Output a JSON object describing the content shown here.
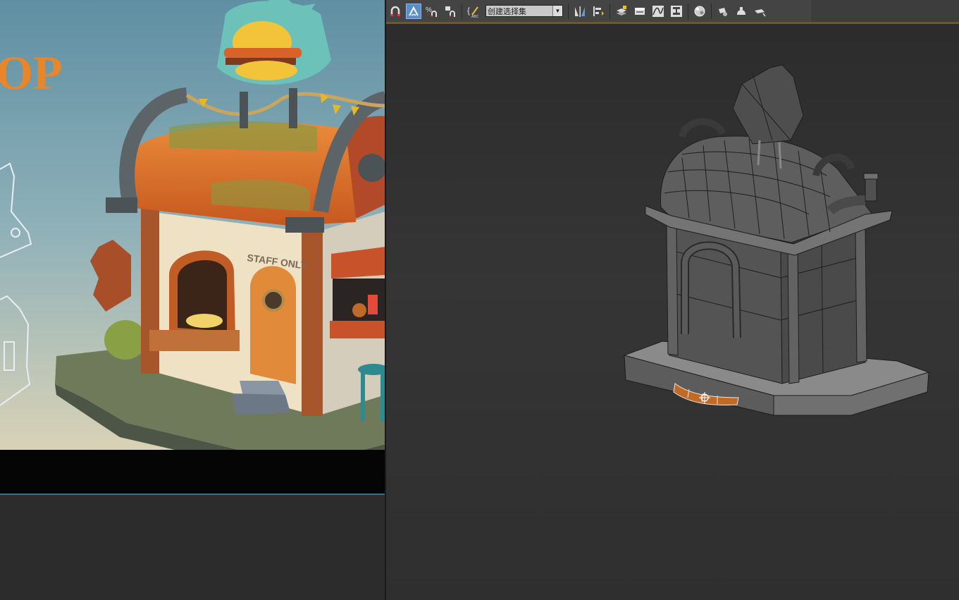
{
  "reference": {
    "title_fragment": "OP",
    "sign_text": "STAFF ONLY"
  },
  "toolbar": {
    "items": [
      "snap-toggle",
      "angle-snap",
      "percent-snap",
      "spinner-snap",
      "edit-named-selection",
      "named-selection-set",
      "mirror",
      "align",
      "toggle-layer-explorer",
      "toggle-scene-explorer",
      "curve-editor",
      "schematic-view",
      "material-editor",
      "render-setup",
      "rendered-frame-window",
      "render-production"
    ],
    "named_selection_set": "创建选择集",
    "accent": "#5a8ec7"
  },
  "viewport": {
    "name": "perspective-viewport",
    "selection_color": "#c26a24"
  }
}
